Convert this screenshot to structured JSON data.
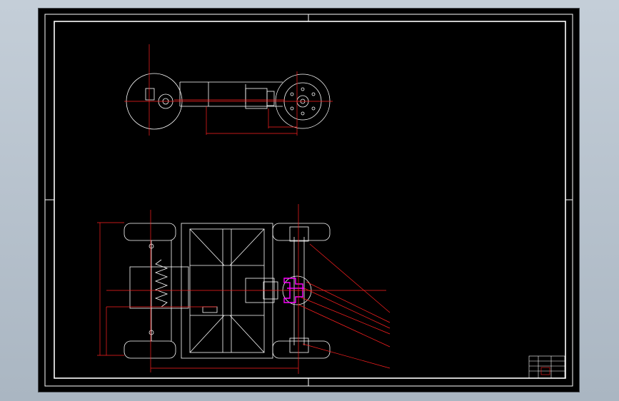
{
  "viewport": {
    "title": ""
  },
  "colors": {
    "background": "#000000",
    "frame": "#ffffff",
    "dimension": "#ff2020",
    "highlight": "#ff00ff",
    "app_chrome": "#b9c4cf"
  },
  "views": {
    "side_view": {
      "label": ""
    },
    "plan_view": {
      "label": ""
    }
  },
  "leaders": {
    "count": 6
  },
  "title_block": {
    "present": true
  }
}
